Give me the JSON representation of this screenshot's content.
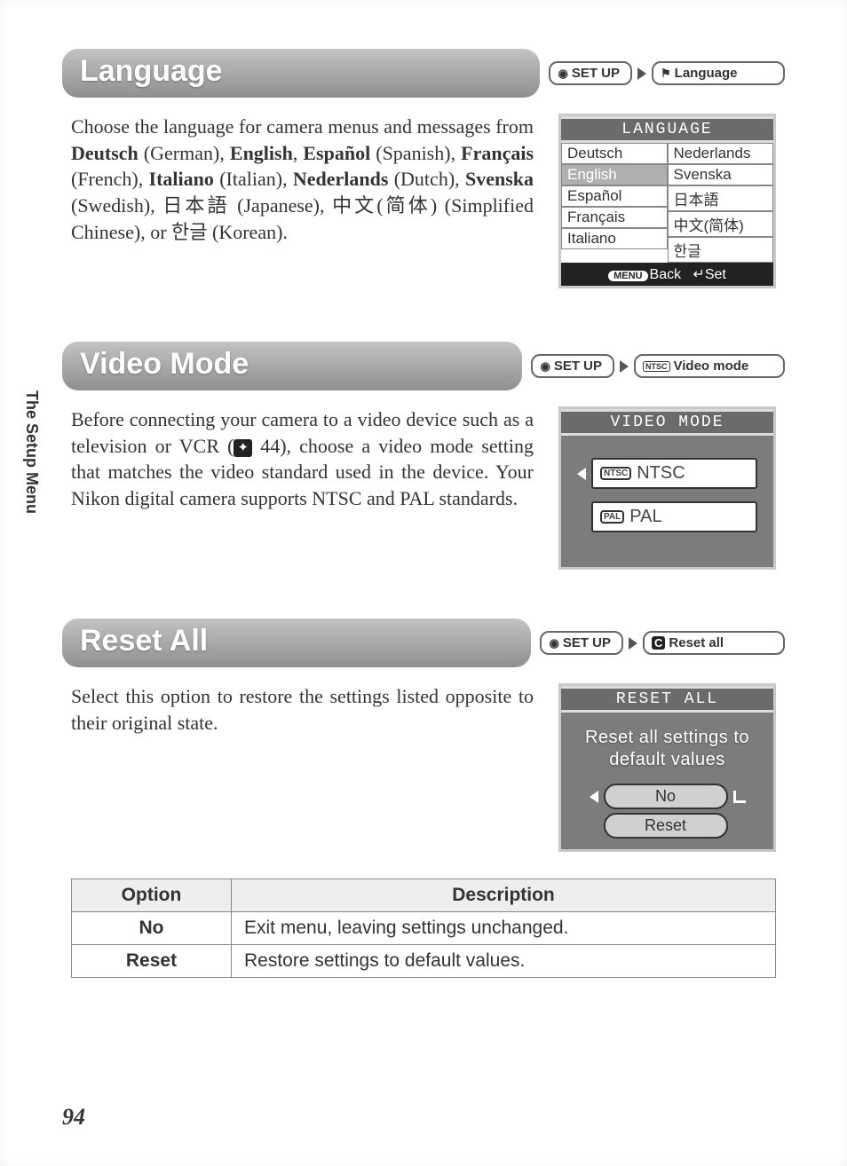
{
  "sideTab": "The Setup Menu",
  "pageNumber": "94",
  "sections": {
    "language": {
      "title": "Language",
      "crumb1": "SET UP",
      "crumb2": "Language",
      "body_html": "Choose the language for camera menus and messages from <b>Deutsch</b> (German), <b>English</b>, <b>Español</b> (Spanish), <b>Français</b> (French), <b>Italiano</b> (Italian), <b>Nederlands</b> (Dutch), <b>Svenska</b> (Swedish), 日本語 (Japanese), 中文(简体) (Simplified Chinese), or 한글 (Korean).",
      "panelTitle": "LANGUAGE",
      "col1": [
        "Deutsch",
        "English",
        "Español",
        "Français",
        "Italiano"
      ],
      "col2": [
        "Nederlands",
        "Svenska",
        "日本語",
        "中文(简体)",
        "한글"
      ],
      "selectedIndex": 1,
      "footerBack": "Back",
      "footerBackTag": "MENU",
      "footerSet": "Set"
    },
    "video": {
      "title": "Video Mode",
      "crumb1": "SET UP",
      "crumb2": "Video mode",
      "crumb2IconText": "NTSC",
      "body_pre": "Before connecting your camera to a video device such as a television or VCR (",
      "body_ref": "44",
      "body_post": "), choose a video mode setting that matches the video standard used in the device. Your Nikon digital camera supports NTSC and PAL standards.",
      "panelTitle": "VIDEO MODE",
      "options": [
        {
          "tag": "NTSC",
          "label": "NTSC",
          "selected": true
        },
        {
          "tag": "PAL",
          "label": "PAL",
          "selected": false
        }
      ]
    },
    "reset": {
      "title": "Reset All",
      "crumb1": "SET UP",
      "crumb2": "Reset all",
      "crumb2IconText": "C",
      "body": "Select this option to restore the settings listed opposite to their original state.",
      "panelTitle": "RESET ALL",
      "message": "Reset all settings to default values",
      "optNo": "No",
      "optReset": "Reset",
      "table": {
        "headOption": "Option",
        "headDesc": "Description",
        "rows": [
          {
            "opt": "No",
            "desc": "Exit menu, leaving settings unchanged."
          },
          {
            "opt": "Reset",
            "desc": "Restore settings to default values."
          }
        ]
      }
    }
  }
}
